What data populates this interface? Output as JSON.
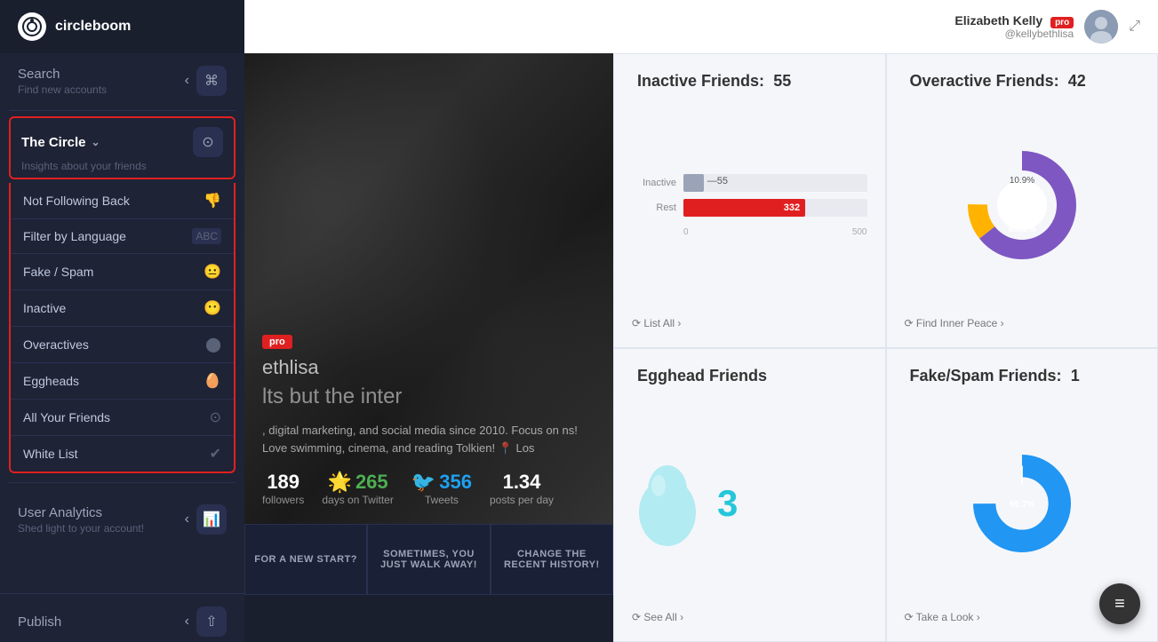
{
  "sidebar": {
    "logo": {
      "icon": "⟳",
      "text": "circleboom"
    },
    "search": {
      "title": "Search",
      "subtitle": "Find new accounts",
      "chevron": "‹",
      "action_icon": "⌘"
    },
    "the_circle": {
      "title": "The Circle",
      "chevron": "⌄",
      "subtitle": "Insights about your friends",
      "settings_icon": "⊙"
    },
    "submenu_items": [
      {
        "label": "Not Following Back",
        "icon": "👎"
      },
      {
        "label": "Filter by Language",
        "icon": "🔤"
      },
      {
        "label": "Fake / Spam",
        "icon": "😐"
      },
      {
        "label": "Inactive",
        "icon": "😶"
      },
      {
        "label": "Overactives",
        "icon": "⬤"
      },
      {
        "label": "Eggheads",
        "icon": "🥚"
      },
      {
        "label": "All Your Friends",
        "icon": "⊙"
      },
      {
        "label": "White List",
        "icon": "✔"
      }
    ],
    "user_analytics": {
      "title": "User Analytics",
      "subtitle": "Shed light to your account!",
      "chevron": "‹",
      "action_icon": "📊"
    },
    "publish": {
      "title": "Publish",
      "chevron": "‹",
      "action_icon": "⇧"
    }
  },
  "topbar": {
    "user_name": "Elizabeth Kelly",
    "user_handle": "@kellybethlisa",
    "pro_badge": "pro",
    "expand_icon": "⤢"
  },
  "profile": {
    "pro_tag": "pro",
    "username": "ethlisa",
    "tagline": "lts but the inter",
    "bio": ", digital marketing, and social media since 2010. Focus on\nns! Love swimming, cinema, and reading Tolkien! 📍 Los",
    "stats": [
      {
        "number": "189",
        "label": "followers",
        "color": "normal"
      },
      {
        "number": "265",
        "label": "days on Twitter",
        "color": "green"
      },
      {
        "number": "356",
        "label": "Tweets",
        "color": "twitter"
      },
      {
        "number": "1.34",
        "label": "posts per day",
        "color": "normal"
      }
    ]
  },
  "promo_cards": [
    {
      "label": "FOR A NEW START?"
    },
    {
      "label": "SOMETIMES, YOU JUST WALK AWAY!"
    },
    {
      "label": "CHANGE THE RECENT HISTORY!"
    }
  ],
  "inactive_friends": {
    "title": "Inactive Friends:",
    "count": "55",
    "bar_data": [
      {
        "label": "Inactive",
        "value": 55,
        "max": 500,
        "color": "#9ba3b8",
        "show_outside": true
      },
      {
        "label": "Rest",
        "value": 332,
        "max": 500,
        "color": "#e02020",
        "show_outside": false
      }
    ],
    "axis": [
      "0",
      "500"
    ],
    "link_text": "⟳ List All ›"
  },
  "overactive_friends": {
    "title": "Overactive Friends:",
    "count": "42",
    "donut": {
      "outer_pct": 89.1,
      "inner_pct": 10.9,
      "outer_color": "#7e57c2",
      "inner_color": "#ffb300",
      "label_outer": "89.1%",
      "label_inner": "10.9%"
    },
    "link_text": "⟳ Find Inner Peace ›"
  },
  "egghead_friends": {
    "title": "Egghead Friends",
    "count": "3",
    "link_text": "⟳ See All ›"
  },
  "fake_spam_friends": {
    "title": "Fake/Spam Friends:",
    "count": "1",
    "donut": {
      "pct": 99.7,
      "color": "#2196f3",
      "label": "99.7%"
    },
    "link_text": "⟳ Take a Look ›"
  },
  "fab": {
    "icon": "≡"
  }
}
